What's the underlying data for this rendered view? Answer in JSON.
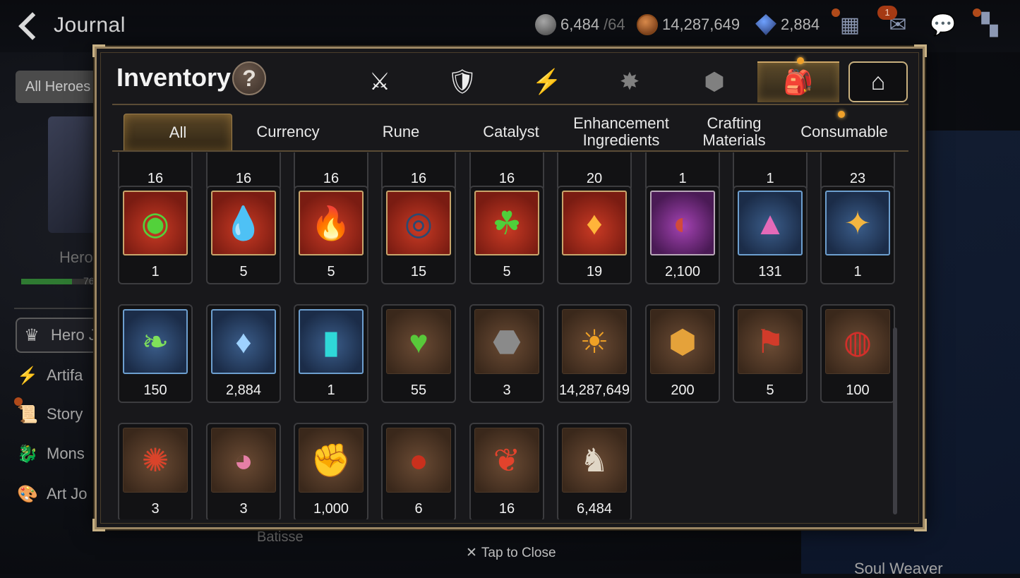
{
  "header": {
    "title": "Journal",
    "stamina": {
      "value": "6,484",
      "max": "/64",
      "icon": "stamina-icon"
    },
    "gold": {
      "value": "14,287,649",
      "icon": "gold-coin-icon"
    },
    "skystone": {
      "value": "2,884",
      "icon": "skystone-icon"
    },
    "mail_badge": "1"
  },
  "left": {
    "all_heroes": "All Heroes",
    "hero_label": "Hero",
    "hero_num": "76",
    "nav": [
      {
        "label": "Hero J",
        "icon": "hero-icon"
      },
      {
        "label": "Artifa",
        "icon": "lightning-icon"
      },
      {
        "label": "Story",
        "icon": "scroll-icon"
      },
      {
        "label": "Mons",
        "icon": "dragon-icon"
      },
      {
        "label": "Art Jo",
        "icon": "palette-icon"
      }
    ]
  },
  "background": {
    "batisse": "Batisse",
    "soul_weaver": "Soul Weaver"
  },
  "inventory": {
    "title": "Inventory",
    "help": "?",
    "categories": [
      {
        "icon": "knight-shield-icon",
        "glyph": "⚔"
      },
      {
        "icon": "crossed-swords-shield-icon",
        "glyph": "🛡"
      },
      {
        "icon": "lightning-icon",
        "glyph": "⚡"
      },
      {
        "icon": "rune-splash-icon",
        "glyph": "✸"
      },
      {
        "icon": "cube-icon",
        "glyph": "⬢"
      },
      {
        "icon": "backpack-icon",
        "glyph": "🎒"
      },
      {
        "icon": "house-icon",
        "glyph": "⌂"
      }
    ],
    "sub_tabs": [
      "All",
      "Currency",
      "Rune",
      "Catalyst",
      "Enhancement Ingredients",
      "Crafting Materials",
      "Consumable"
    ],
    "items": [
      {
        "name": "green-gem-item",
        "glyph": "◉",
        "color": "#53d13b",
        "count": "1",
        "bg": "red"
      },
      {
        "name": "blue-flame-charm-item",
        "glyph": "💧",
        "color": "#36b6e6",
        "count": "5",
        "bg": "red"
      },
      {
        "name": "fire-charm-item",
        "glyph": "🔥",
        "color": "#ff6a2a",
        "count": "5",
        "bg": "red"
      },
      {
        "name": "dark-disc-item",
        "glyph": "◎",
        "color": "#2b4a72",
        "count": "15",
        "bg": "red"
      },
      {
        "name": "clover-charm-item",
        "glyph": "☘",
        "color": "#4fcf3a",
        "count": "5",
        "bg": "red"
      },
      {
        "name": "flame-crystal-item",
        "glyph": "♦",
        "color": "#ffb43a",
        "count": "19",
        "bg": "red"
      },
      {
        "name": "dark-ring-item",
        "glyph": "◐",
        "color": "#d24a3a",
        "count": "2,100",
        "bg": "purple"
      },
      {
        "name": "pink-mountain-item",
        "glyph": "▲",
        "color": "#e46ab8",
        "count": "131",
        "bg": "blue"
      },
      {
        "name": "star-charm-item",
        "glyph": "✦",
        "color": "#f3b540",
        "count": "1",
        "bg": "blue"
      },
      {
        "name": "leaf-item",
        "glyph": "❧",
        "color": "#7fe05a",
        "count": "150",
        "bg": "blue"
      },
      {
        "name": "skystone-crystal-item",
        "glyph": "♦",
        "color": "#9fd2ff",
        "count": "2,884",
        "bg": "blue"
      },
      {
        "name": "cyan-crystal-item",
        "glyph": "▮",
        "color": "#2fd8d8",
        "count": "1",
        "bg": "blue"
      },
      {
        "name": "green-heart-item",
        "glyph": "♥",
        "color": "#58c83a",
        "count": "55",
        "bg": "brown"
      },
      {
        "name": "stone-compass-item",
        "glyph": "⬣",
        "color": "#8a8a8a",
        "count": "3",
        "bg": "brown"
      },
      {
        "name": "gold-coin-item",
        "glyph": "☀",
        "color": "#f0a125",
        "count": "14,287,649",
        "bg": "brown"
      },
      {
        "name": "gold-hexagon-item",
        "glyph": "⬢",
        "color": "#e5a23a",
        "count": "200",
        "bg": "brown"
      },
      {
        "name": "red-banner-item",
        "glyph": "⚑",
        "color": "#d23b2a",
        "count": "5",
        "bg": "brown"
      },
      {
        "name": "red-bracelet-item",
        "glyph": "◍",
        "color": "#d12f2a",
        "count": "100",
        "bg": "brown"
      },
      {
        "name": "red-seal-item",
        "glyph": "✺",
        "color": "#d9432a",
        "count": "3",
        "bg": "brown"
      },
      {
        "name": "robot-drone-item",
        "glyph": "◕",
        "color": "#e57fa6",
        "count": "3",
        "bg": "brown"
      },
      {
        "name": "gold-fist-emblem-item",
        "glyph": "✊",
        "color": "#e9b04a",
        "count": "1,000",
        "bg": "brown"
      },
      {
        "name": "lava-orb-item",
        "glyph": "●",
        "color": "#c9301d",
        "count": "6",
        "bg": "brown"
      },
      {
        "name": "red-leaves-item",
        "glyph": "❦",
        "color": "#e2432c",
        "count": "16",
        "bg": "brown"
      },
      {
        "name": "stamina-horse-item",
        "glyph": "♞",
        "color": "#e0d6c6",
        "count": "6,484",
        "bg": "brown"
      }
    ],
    "partial_row_counts": [
      "16",
      "16",
      "16",
      "16",
      "16",
      "20",
      "1",
      "1",
      "23"
    ]
  },
  "footer": {
    "close_label": "Tap to Close",
    "close_icon": "close-x-icon"
  },
  "colors": {
    "frame": "#9b8663",
    "modal_bg": "#18181b",
    "active_tab": "#5a4626"
  }
}
